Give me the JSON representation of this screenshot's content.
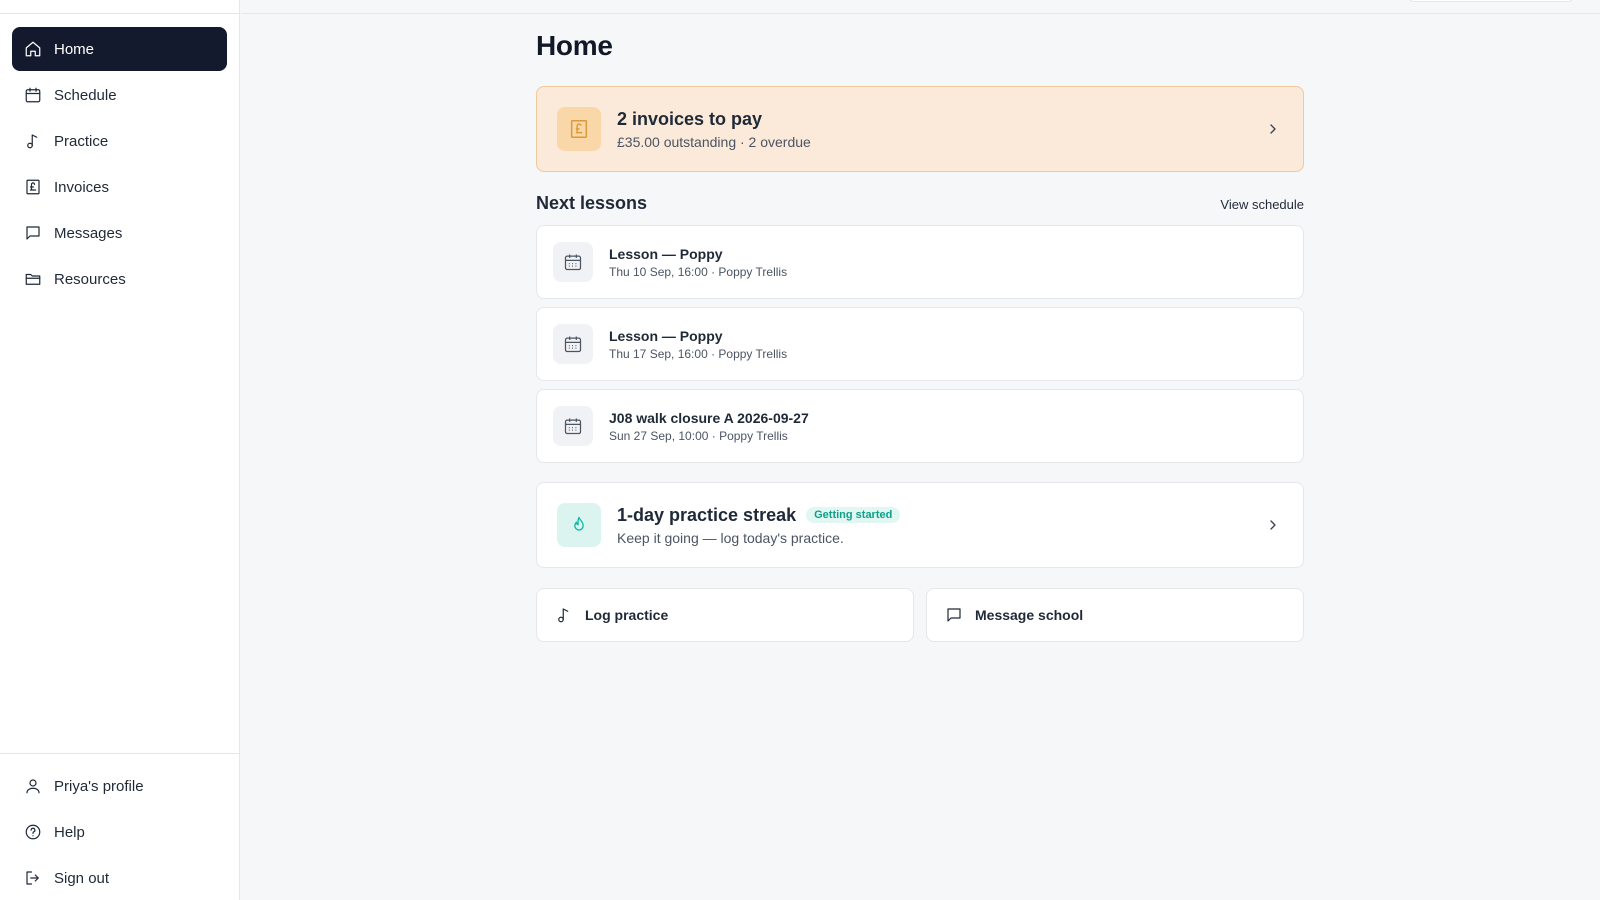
{
  "sidebar": {
    "items": [
      {
        "label": "Home",
        "icon": "home-icon",
        "active": true
      },
      {
        "label": "Schedule",
        "icon": "calendar-icon"
      },
      {
        "label": "Practice",
        "icon": "music-note-icon"
      },
      {
        "label": "Invoices",
        "icon": "pound-receipt-icon"
      },
      {
        "label": "Messages",
        "icon": "message-icon"
      },
      {
        "label": "Resources",
        "icon": "folder-icon"
      }
    ],
    "bottom": [
      {
        "label": "Priya's profile",
        "icon": "user-icon"
      },
      {
        "label": "Help",
        "icon": "help-circle-icon"
      },
      {
        "label": "Sign out",
        "icon": "sign-out-icon"
      }
    ]
  },
  "main": {
    "title": "Home",
    "invoice_card": {
      "title": "2 invoices to pay",
      "subtitle": "£35.00 outstanding · 2 overdue"
    },
    "next_lessons": {
      "title": "Next lessons",
      "view_link": "View schedule",
      "lessons": [
        {
          "title": "Lesson — Poppy",
          "detail": "Thu 10 Sep, 16:00 · Poppy Trellis"
        },
        {
          "title": "Lesson — Poppy",
          "detail": "Thu 17 Sep, 16:00 · Poppy Trellis"
        },
        {
          "title": "J08 walk closure A 2026-09-27",
          "detail": "Sun 27 Sep, 10:00 · Poppy Trellis"
        }
      ]
    },
    "streak_card": {
      "title": "1-day practice streak",
      "badge": "Getting started",
      "subtitle": "Keep it going — log today's practice."
    },
    "actions": {
      "log_practice": "Log practice",
      "message_school": "Message school"
    }
  },
  "colors": {
    "active_nav": "#141a2e",
    "invoice_bg": "#fbe9d9",
    "invoice_border": "#f2c89d",
    "streak_accent": "#14b8a6"
  }
}
